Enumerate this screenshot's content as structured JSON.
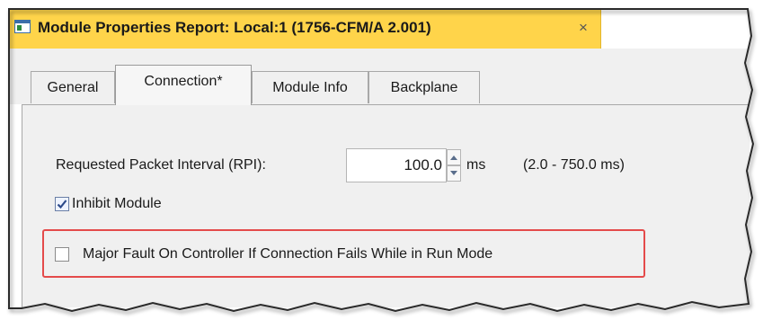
{
  "window": {
    "title": "Module Properties Report: Local:1 (1756-CFM/A 2.001)",
    "close_glyph": "×",
    "title_icon": "window-icon",
    "title_bar_color": "#ffd44a"
  },
  "tabs": [
    {
      "label": "General",
      "active": false
    },
    {
      "label": "Connection*",
      "active": true
    },
    {
      "label": "Module Info",
      "active": false
    },
    {
      "label": "Backplane",
      "active": false
    }
  ],
  "connection": {
    "rpi_label": "Requested Packet Interval (RPI):",
    "rpi_value": "100.0",
    "rpi_unit": "ms",
    "rpi_range": "(2.0 - 750.0 ms)",
    "inhibit_label": "Inhibit Module",
    "inhibit_checked": true,
    "major_fault_label": "Major Fault On Controller If Connection Fails While in Run Mode",
    "major_fault_checked": false
  },
  "colors": {
    "highlight": "#e44b4b",
    "panel": "#f0f0f0"
  }
}
